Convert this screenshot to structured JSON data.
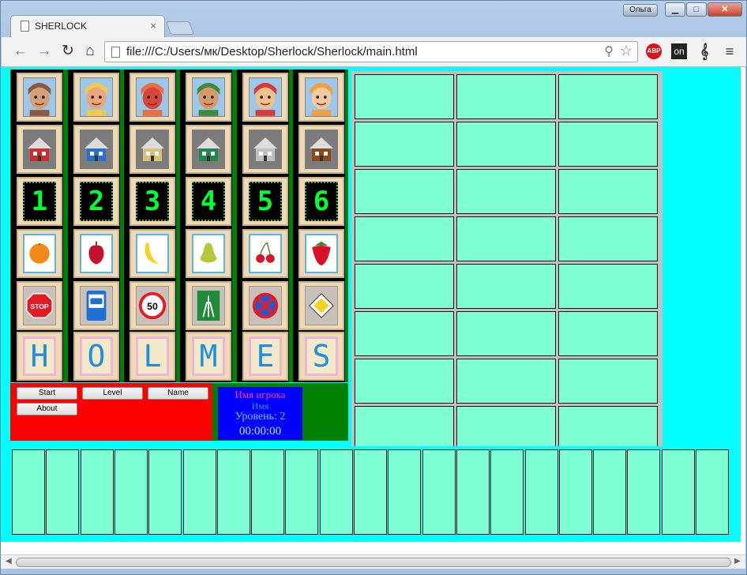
{
  "browser": {
    "tab_title": "SHERLOCK",
    "tab_close": "×",
    "user_name": "Ольга",
    "url": "file:///C:/Users/мк/Desktop/Sherlock/Sherlock/main.html",
    "ext_abp": "ABP",
    "ext_on": "on",
    "ext_clef": "𝄞",
    "menu_glyph": "≡",
    "min_glyph": "▁",
    "max_glyph": "□",
    "close_glyph": "✕"
  },
  "board": {
    "portraits": [
      "bearded-man",
      "blond-man",
      "red-hair-girl",
      "green-hat-man",
      "red-hat-woman",
      "blonde-woman"
    ],
    "house_colors": [
      "#d22b2b",
      "#2b6fd2",
      "#d8c27a",
      "#1e8a4a",
      "#c0c0c0",
      "#8a4a1e"
    ],
    "numbers": [
      "1",
      "2",
      "3",
      "4",
      "5",
      "6"
    ],
    "fruits": [
      "orange",
      "apple",
      "banana",
      "pear",
      "cherries",
      "strawberry"
    ],
    "signs": [
      "STOP",
      "bus-stop",
      "50",
      "motorway",
      "no-stopping",
      "priority-road"
    ],
    "letters": [
      "H",
      "O",
      "L",
      "M",
      "E",
      "S"
    ]
  },
  "controls": {
    "start": "Start",
    "level": "Level",
    "name": "Name",
    "about": "About"
  },
  "info": {
    "player_label": "Имя игрока",
    "name": "Имя",
    "level": "Уровень: 2",
    "time": "00:00:00"
  }
}
